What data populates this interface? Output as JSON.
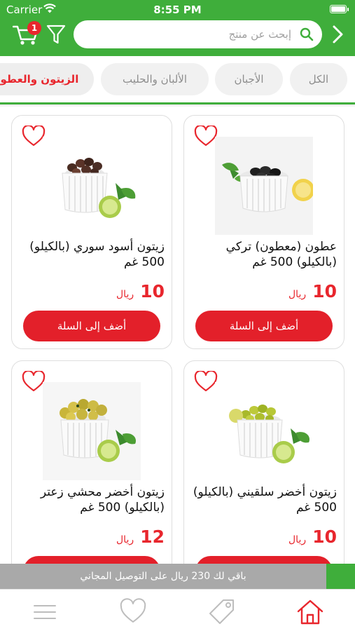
{
  "status_bar": {
    "carrier": "Carrier",
    "time": "8:55 PM"
  },
  "header": {
    "cart_count": "1",
    "search_placeholder": "إبحث عن منتج",
    "search_value": ""
  },
  "colors": {
    "brand_green": "#3fae3b",
    "accent_red": "#e8262d",
    "banner_gray": "#a9a9a9"
  },
  "categories": {
    "items": [
      {
        "label": "الكل",
        "active": false
      },
      {
        "label": "الأجبان",
        "active": false
      },
      {
        "label": "الألبان والحليب",
        "active": false
      },
      {
        "label": "الزيتون والعطون",
        "active": true
      }
    ]
  },
  "products": [
    {
      "name": "عطون (معطون) تركي (بالكيلو) 500 غم",
      "price": "10",
      "currency": "ريال",
      "add_label": "أضف إلى السلة",
      "image": "black-olives-bowl-image"
    },
    {
      "name": "زيتون أسود سوري (بالكيلو) 500 غم",
      "price": "10",
      "currency": "ريال",
      "add_label": "أضف إلى السلة",
      "image": "dark-olives-bowl-image"
    },
    {
      "name": "زيتون أخضر سلقيني (بالكيلو) 500 غم",
      "price": "10",
      "currency": "ريال",
      "add_label": "أضف إلى السلة",
      "image": "green-olives-bowl-image"
    },
    {
      "name": "زيتون أخضر محشي زعتر (بالكيلو) 500 غم",
      "price": "12",
      "currency": "ريال",
      "add_label": "أضف إلى السلة",
      "image": "stuffed-olives-bowl-image"
    }
  ],
  "delivery_banner": {
    "text": "باقي لك 230 ريال على التوصيل المجاني"
  },
  "bottom_nav": {
    "items": [
      {
        "icon": "menu-icon"
      },
      {
        "icon": "heart-icon"
      },
      {
        "icon": "tag-icon"
      },
      {
        "icon": "home-icon",
        "active": true
      }
    ]
  }
}
